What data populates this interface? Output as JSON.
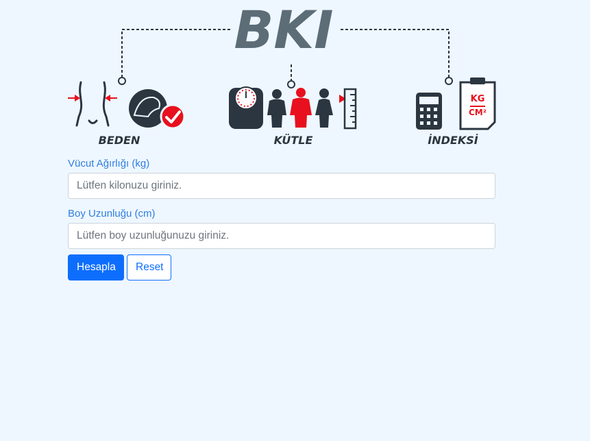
{
  "hero": {
    "title": "BKI",
    "word_beden": "BEDEN",
    "word_kutle": "KÜTLE",
    "word_indeksi": "İNDEKSİ",
    "badge_kg": "KG",
    "badge_cm": "CM²",
    "accent_color": "#e8101e",
    "dark_color": "#2b3640",
    "title_color": "#5d6d78"
  },
  "form": {
    "weight_label": "Vücut Ağırlığı (kg)",
    "weight_placeholder": "Lütfen kilonuzu giriniz.",
    "weight_value": "",
    "height_label": "Boy Uzunluğu (cm)",
    "height_placeholder": "Lütfen boy uzunluğunuzu giriniz.",
    "height_value": "",
    "calculate_label": "Hesapla",
    "reset_label": "Reset"
  },
  "colors": {
    "background": "#eef7ff",
    "primary": "#0d6efd",
    "label": "#2f7fe0"
  }
}
